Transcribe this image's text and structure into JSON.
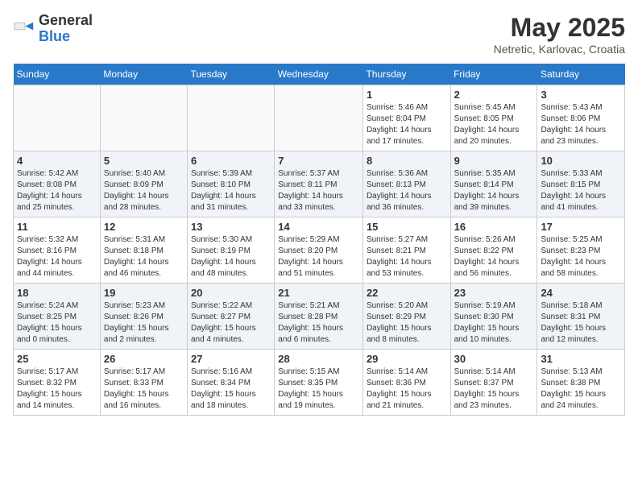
{
  "header": {
    "logo_general": "General",
    "logo_blue": "Blue",
    "month_title": "May 2025",
    "location": "Netretic, Karlovac, Croatia"
  },
  "weekdays": [
    "Sunday",
    "Monday",
    "Tuesday",
    "Wednesday",
    "Thursday",
    "Friday",
    "Saturday"
  ],
  "weeks": [
    [
      {
        "day": "",
        "info": ""
      },
      {
        "day": "",
        "info": ""
      },
      {
        "day": "",
        "info": ""
      },
      {
        "day": "",
        "info": ""
      },
      {
        "day": "1",
        "info": "Sunrise: 5:46 AM\nSunset: 8:04 PM\nDaylight: 14 hours\nand 17 minutes."
      },
      {
        "day": "2",
        "info": "Sunrise: 5:45 AM\nSunset: 8:05 PM\nDaylight: 14 hours\nand 20 minutes."
      },
      {
        "day": "3",
        "info": "Sunrise: 5:43 AM\nSunset: 8:06 PM\nDaylight: 14 hours\nand 23 minutes."
      }
    ],
    [
      {
        "day": "4",
        "info": "Sunrise: 5:42 AM\nSunset: 8:08 PM\nDaylight: 14 hours\nand 25 minutes."
      },
      {
        "day": "5",
        "info": "Sunrise: 5:40 AM\nSunset: 8:09 PM\nDaylight: 14 hours\nand 28 minutes."
      },
      {
        "day": "6",
        "info": "Sunrise: 5:39 AM\nSunset: 8:10 PM\nDaylight: 14 hours\nand 31 minutes."
      },
      {
        "day": "7",
        "info": "Sunrise: 5:37 AM\nSunset: 8:11 PM\nDaylight: 14 hours\nand 33 minutes."
      },
      {
        "day": "8",
        "info": "Sunrise: 5:36 AM\nSunset: 8:13 PM\nDaylight: 14 hours\nand 36 minutes."
      },
      {
        "day": "9",
        "info": "Sunrise: 5:35 AM\nSunset: 8:14 PM\nDaylight: 14 hours\nand 39 minutes."
      },
      {
        "day": "10",
        "info": "Sunrise: 5:33 AM\nSunset: 8:15 PM\nDaylight: 14 hours\nand 41 minutes."
      }
    ],
    [
      {
        "day": "11",
        "info": "Sunrise: 5:32 AM\nSunset: 8:16 PM\nDaylight: 14 hours\nand 44 minutes."
      },
      {
        "day": "12",
        "info": "Sunrise: 5:31 AM\nSunset: 8:18 PM\nDaylight: 14 hours\nand 46 minutes."
      },
      {
        "day": "13",
        "info": "Sunrise: 5:30 AM\nSunset: 8:19 PM\nDaylight: 14 hours\nand 48 minutes."
      },
      {
        "day": "14",
        "info": "Sunrise: 5:29 AM\nSunset: 8:20 PM\nDaylight: 14 hours\nand 51 minutes."
      },
      {
        "day": "15",
        "info": "Sunrise: 5:27 AM\nSunset: 8:21 PM\nDaylight: 14 hours\nand 53 minutes."
      },
      {
        "day": "16",
        "info": "Sunrise: 5:26 AM\nSunset: 8:22 PM\nDaylight: 14 hours\nand 56 minutes."
      },
      {
        "day": "17",
        "info": "Sunrise: 5:25 AM\nSunset: 8:23 PM\nDaylight: 14 hours\nand 58 minutes."
      }
    ],
    [
      {
        "day": "18",
        "info": "Sunrise: 5:24 AM\nSunset: 8:25 PM\nDaylight: 15 hours\nand 0 minutes."
      },
      {
        "day": "19",
        "info": "Sunrise: 5:23 AM\nSunset: 8:26 PM\nDaylight: 15 hours\nand 2 minutes."
      },
      {
        "day": "20",
        "info": "Sunrise: 5:22 AM\nSunset: 8:27 PM\nDaylight: 15 hours\nand 4 minutes."
      },
      {
        "day": "21",
        "info": "Sunrise: 5:21 AM\nSunset: 8:28 PM\nDaylight: 15 hours\nand 6 minutes."
      },
      {
        "day": "22",
        "info": "Sunrise: 5:20 AM\nSunset: 8:29 PM\nDaylight: 15 hours\nand 8 minutes."
      },
      {
        "day": "23",
        "info": "Sunrise: 5:19 AM\nSunset: 8:30 PM\nDaylight: 15 hours\nand 10 minutes."
      },
      {
        "day": "24",
        "info": "Sunrise: 5:18 AM\nSunset: 8:31 PM\nDaylight: 15 hours\nand 12 minutes."
      }
    ],
    [
      {
        "day": "25",
        "info": "Sunrise: 5:17 AM\nSunset: 8:32 PM\nDaylight: 15 hours\nand 14 minutes."
      },
      {
        "day": "26",
        "info": "Sunrise: 5:17 AM\nSunset: 8:33 PM\nDaylight: 15 hours\nand 16 minutes."
      },
      {
        "day": "27",
        "info": "Sunrise: 5:16 AM\nSunset: 8:34 PM\nDaylight: 15 hours\nand 18 minutes."
      },
      {
        "day": "28",
        "info": "Sunrise: 5:15 AM\nSunset: 8:35 PM\nDaylight: 15 hours\nand 19 minutes."
      },
      {
        "day": "29",
        "info": "Sunrise: 5:14 AM\nSunset: 8:36 PM\nDaylight: 15 hours\nand 21 minutes."
      },
      {
        "day": "30",
        "info": "Sunrise: 5:14 AM\nSunset: 8:37 PM\nDaylight: 15 hours\nand 23 minutes."
      },
      {
        "day": "31",
        "info": "Sunrise: 5:13 AM\nSunset: 8:38 PM\nDaylight: 15 hours\nand 24 minutes."
      }
    ]
  ]
}
